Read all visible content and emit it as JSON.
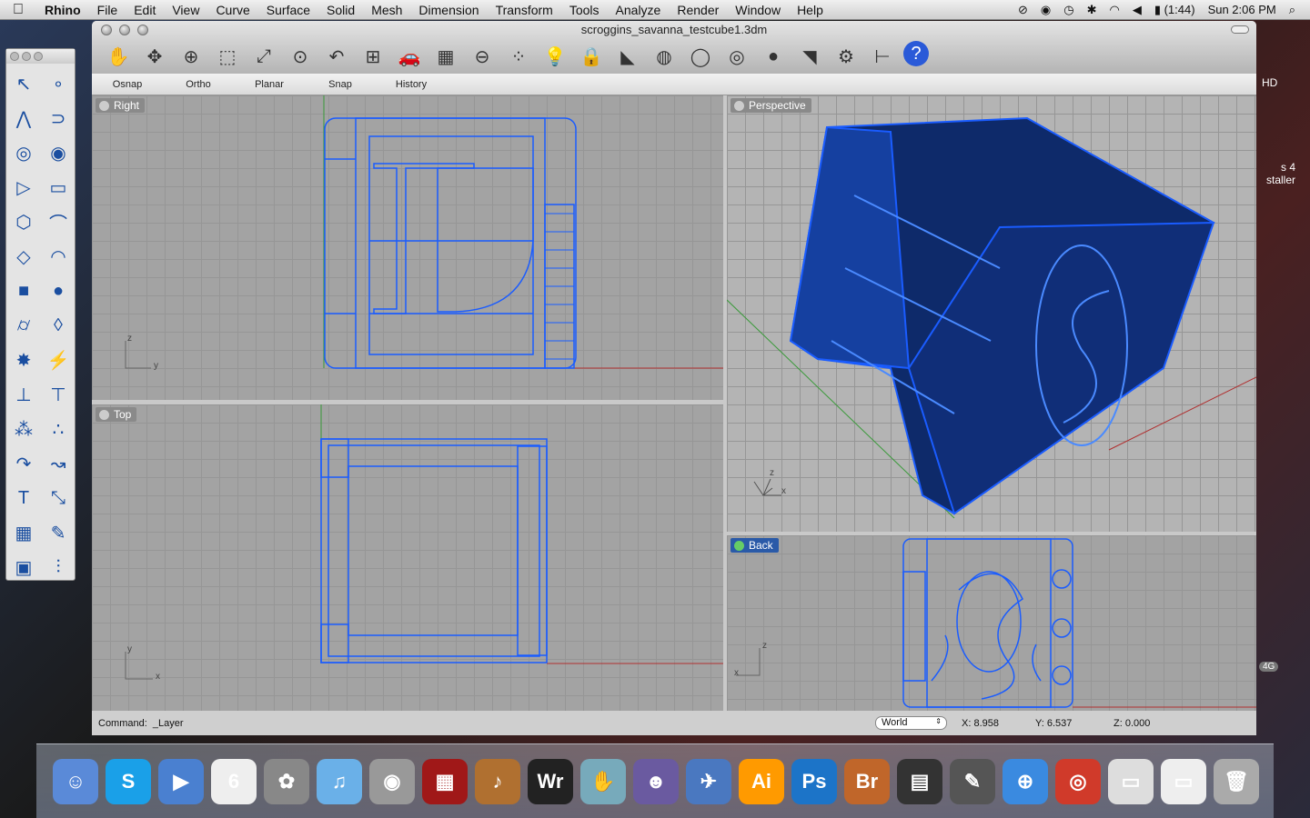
{
  "menubar": {
    "app": "Rhino",
    "items": [
      "File",
      "Edit",
      "View",
      "Curve",
      "Surface",
      "Solid",
      "Mesh",
      "Dimension",
      "Transform",
      "Tools",
      "Analyze",
      "Render",
      "Window",
      "Help"
    ],
    "battery": "(1:44)",
    "clock": "Sun 2:06 PM"
  },
  "window": {
    "title": "scroggins_savanna_testcube1.3dm"
  },
  "toolbar": {
    "icons": [
      "pan-icon",
      "rotate-view-icon",
      "zoom-dynamic-icon",
      "zoom-window-icon",
      "zoom-extents-icon",
      "zoom-selected-icon",
      "undo-view-icon",
      "four-viewports-icon",
      "car-icon",
      "grid-icon",
      "object-snap-icon",
      "points-icon",
      "light-icon",
      "lock-icon",
      "render-icon",
      "color-wheel-icon",
      "wireframe-sphere-icon",
      "shaded-sphere-icon",
      "rendered-sphere-icon",
      "spotlight-icon",
      "settings-gear-icon",
      "dimension-icon",
      "help-icon"
    ]
  },
  "modes": [
    "Osnap",
    "Ortho",
    "Planar",
    "Snap",
    "History"
  ],
  "viewports": {
    "right": "Right",
    "top": "Top",
    "perspective": "Perspective",
    "back": "Back"
  },
  "axes": {
    "z": "z",
    "y": "y",
    "x": "x"
  },
  "status": {
    "command_label": "Command:",
    "command": "_Layer",
    "cplane": "World",
    "x": "X: 8.958",
    "y": "Y: 6.537",
    "z": "Z: 0.000"
  },
  "desktop": {
    "drive": "HD",
    "file": "s 4\nstaller",
    "badge": "4G"
  },
  "dock": {
    "items": [
      {
        "name": "finder",
        "label": "☺",
        "color": "#5a8ad8"
      },
      {
        "name": "skype",
        "label": "S",
        "color": "#1aa0e8"
      },
      {
        "name": "ichat",
        "label": "▶",
        "color": "#4a80d0"
      },
      {
        "name": "ical",
        "label": "6",
        "color": "#eee"
      },
      {
        "name": "iphoto",
        "label": "✿",
        "color": "#888"
      },
      {
        "name": "itunes",
        "label": "♫",
        "color": "#6ab0e8"
      },
      {
        "name": "dvd-player",
        "label": "◉",
        "color": "#999"
      },
      {
        "name": "front-row",
        "label": "▦",
        "color": "#a01818"
      },
      {
        "name": "garageband",
        "label": "♪",
        "color": "#b07030"
      },
      {
        "name": "wordrake",
        "label": "Wr",
        "color": "#222"
      },
      {
        "name": "hand-app",
        "label": "✋",
        "color": "#7ab"
      },
      {
        "name": "taz",
        "label": "☻",
        "color": "#6a5aa0"
      },
      {
        "name": "dragon",
        "label": "✈",
        "color": "#4a78c0"
      },
      {
        "name": "illustrator",
        "label": "Ai",
        "color": "#ff9a00"
      },
      {
        "name": "photoshop",
        "label": "Ps",
        "color": "#1c74c8"
      },
      {
        "name": "bridge",
        "label": "Br",
        "color": "#c0662a"
      },
      {
        "name": "final-cut",
        "label": "▤",
        "color": "#333"
      },
      {
        "name": "pen-app",
        "label": "✎",
        "color": "#555"
      },
      {
        "name": "safari",
        "label": "⊕",
        "color": "#3a8ae0"
      },
      {
        "name": "chrome",
        "label": "◎",
        "color": "#d03a2a"
      },
      {
        "name": "document",
        "label": "▭",
        "color": "#ddd"
      },
      {
        "name": "document2",
        "label": "▭",
        "color": "#eee"
      },
      {
        "name": "trash",
        "label": "🗑",
        "color": "#aaa"
      }
    ]
  },
  "colors": {
    "wire": "#1a5cff",
    "accent": "#2a5aa8"
  }
}
